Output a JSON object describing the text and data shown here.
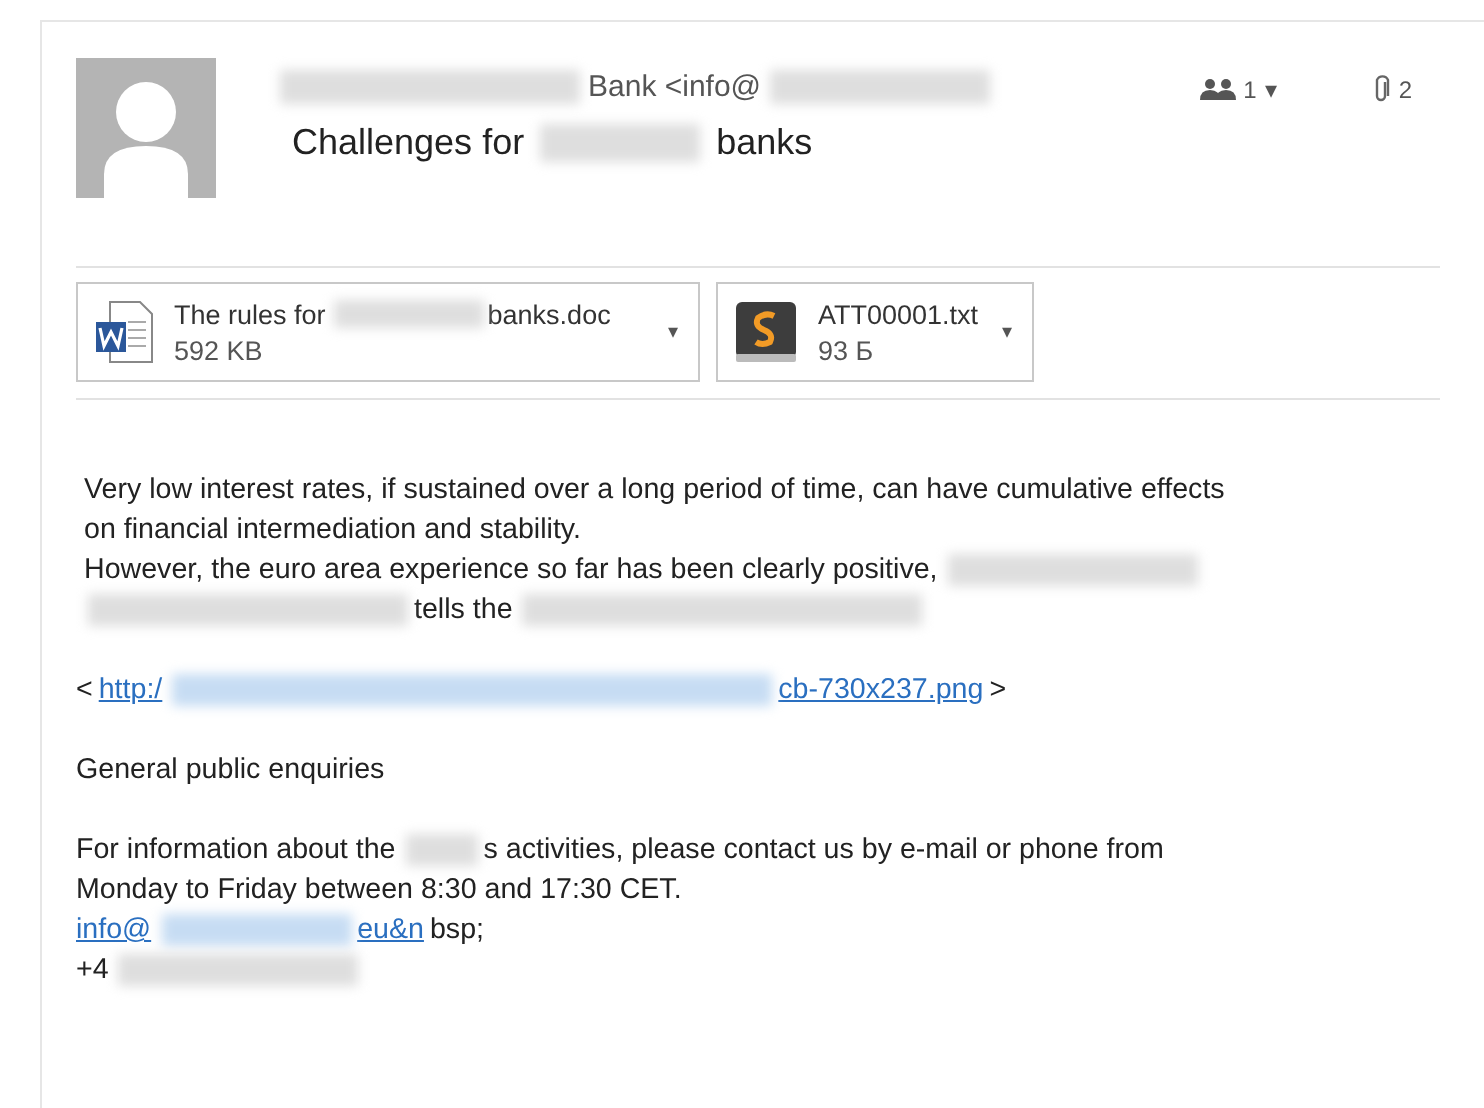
{
  "header": {
    "sender": [
      {
        "kind": "redacted"
      },
      {
        "kind": "text",
        "text": "Bank <info@"
      },
      {
        "kind": "redacted"
      }
    ],
    "subject": [
      {
        "kind": "text",
        "text": "Challenges for"
      },
      {
        "kind": "redacted"
      },
      {
        "kind": "text",
        "text": "banks"
      }
    ],
    "recipients": {
      "count": "1",
      "caret": "▾"
    },
    "attachments_count": "2"
  },
  "attachments": [
    {
      "kind": "word",
      "name": [
        {
          "kind": "text",
          "text": "The rules for"
        },
        {
          "kind": "redacted"
        },
        {
          "kind": "text",
          "text": "banks.doc"
        }
      ],
      "size": "592 KB",
      "caret": "▾"
    },
    {
      "kind": "sublime",
      "name": [
        {
          "kind": "text",
          "text": "ATT00001.txt"
        }
      ],
      "size": "93 Б",
      "caret": "▾"
    }
  ],
  "body": [
    {
      "lines": [
        [
          {
            "kind": "text",
            "text": "Very low interest rates, if sustained over a long period of time, can have cumulative effects\non financial intermediation and stability."
          }
        ],
        [
          {
            "kind": "text",
            "text": "However, the euro area experience so far has been clearly positive,"
          },
          {
            "kind": "redacted"
          }
        ],
        [
          {
            "kind": "redacted"
          },
          {
            "kind": "text",
            "text": "tells the"
          },
          {
            "kind": "redacted"
          }
        ]
      ]
    },
    {
      "lines": [
        [
          {
            "kind": "text",
            "text": "<"
          },
          {
            "kind": "link",
            "text": "http:/"
          },
          {
            "kind": "redacted-link"
          },
          {
            "kind": "link",
            "text": "cb-730x237.png"
          },
          {
            "kind": "text",
            "text": ">"
          }
        ]
      ]
    },
    {
      "lines": [
        [
          {
            "kind": "text",
            "text": "General public enquiries"
          }
        ]
      ]
    },
    {
      "lines": [
        [
          {
            "kind": "text",
            "text": "For information about the"
          },
          {
            "kind": "redacted"
          },
          {
            "kind": "text",
            "text": "s activities, please contact us by e-mail or phone  from"
          }
        ],
        [
          {
            "kind": "text",
            "text": "Monday to Friday between 8:30 and 17:30 CET."
          }
        ],
        [
          {
            "kind": "link",
            "text": "info@"
          },
          {
            "kind": "redacted-link"
          },
          {
            "kind": "link",
            "text": "eu&n"
          },
          {
            "kind": "text",
            "text": "bsp;"
          }
        ],
        [
          {
            "kind": "text",
            "text": "+4"
          },
          {
            "kind": "redacted"
          }
        ]
      ]
    }
  ]
}
